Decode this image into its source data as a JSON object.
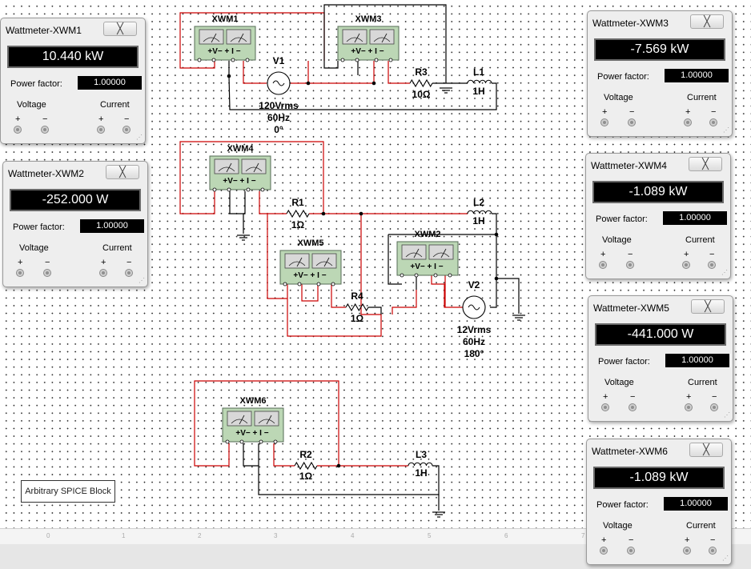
{
  "wattmeters": [
    {
      "title": "Wattmeter-XWM1",
      "reading": "10.440 kW",
      "pf_label": "Power factor:",
      "pf": "1.00000",
      "voltage": "Voltage",
      "current": "Current"
    },
    {
      "title": "Wattmeter-XWM2",
      "reading": "-252.000 W",
      "pf_label": "Power factor:",
      "pf": "1.00000",
      "voltage": "Voltage",
      "current": "Current"
    },
    {
      "title": "Wattmeter-XWM3",
      "reading": "-7.569 kW",
      "pf_label": "Power factor:",
      "pf": "1.00000",
      "voltage": "Voltage",
      "current": "Current"
    },
    {
      "title": "Wattmeter-XWM4",
      "reading": "-1.089 kW",
      "pf_label": "Power factor:",
      "pf": "1.00000",
      "voltage": "Voltage",
      "current": "Current"
    },
    {
      "title": "Wattmeter-XWM5",
      "reading": "-441.000 W",
      "pf_label": "Power factor:",
      "pf": "1.00000",
      "voltage": "Voltage",
      "current": "Current"
    },
    {
      "title": "Wattmeter-XWM6",
      "reading": "-1.089 kW",
      "pf_label": "Power factor:",
      "pf": "1.00000",
      "voltage": "Voltage",
      "current": "Current"
    }
  ],
  "close_glyph": "╳",
  "sign_plus": "+",
  "sign_minus": "−",
  "circuit": {
    "meters": [
      "XWM1",
      "XWM3",
      "XWM4",
      "XWM5",
      "XWM2",
      "XWM6"
    ],
    "meter_terminals": "+V−   + I −",
    "sources": [
      {
        "name": "V1",
        "lines": [
          "120Vrms",
          "60Hz",
          "0°"
        ]
      },
      {
        "name": "V2",
        "lines": [
          "12Vrms",
          "60Hz",
          "180°"
        ]
      }
    ],
    "resistors": [
      {
        "name": "R3",
        "value": "10Ω"
      },
      {
        "name": "R1",
        "value": "1Ω"
      },
      {
        "name": "R4",
        "value": "1Ω"
      },
      {
        "name": "R2",
        "value": "1Ω"
      }
    ],
    "inductors": [
      {
        "name": "L1",
        "value": "1H"
      },
      {
        "name": "L2",
        "value": "1H"
      },
      {
        "name": "L3",
        "value": "1H"
      }
    ]
  },
  "spice_block": "Arbitrary SPICE Block",
  "ruler_ticks": [
    "0",
    "1",
    "2",
    "3",
    "4",
    "5",
    "6",
    "7"
  ],
  "colors": {
    "wire_red": "#cc0000",
    "wire_black": "#000000",
    "meter_fill": "#bcd7b5",
    "display_bg": "#000000"
  }
}
